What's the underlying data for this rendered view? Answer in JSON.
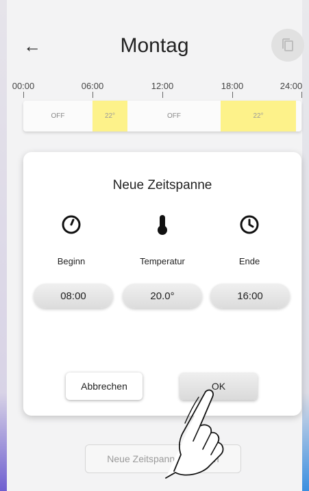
{
  "header": {
    "title": "Montag",
    "back_icon": "arrow-left-icon",
    "copy_icon": "copy-icon"
  },
  "timeline": {
    "ticks": [
      "00:00",
      "06:00",
      "12:00",
      "18:00",
      "24:00"
    ],
    "segments": [
      {
        "label": "OFF",
        "kind": "off"
      },
      {
        "label": "22°",
        "kind": "warm"
      },
      {
        "label": "OFF",
        "kind": "off"
      },
      {
        "label": "22°",
        "kind": "warm"
      }
    ]
  },
  "dialog": {
    "title": "Neue Zeitspanne",
    "start": {
      "label": "Beginn",
      "value": "08:00",
      "icon": "clock-start-icon"
    },
    "temperature": {
      "label": "Temperatur",
      "value": "20.0°",
      "icon": "thermometer-icon"
    },
    "end": {
      "label": "Ende",
      "value": "16:00",
      "icon": "clock-end-icon"
    },
    "cancel_label": "Abbrechen",
    "ok_label": "OK"
  },
  "create_button_label": "Neue Zeitspanne erstellen",
  "colors": {
    "warm_segment": "#fdf28a",
    "accent_left": "#6f5fd0",
    "accent_right": "#3b8fe0"
  }
}
